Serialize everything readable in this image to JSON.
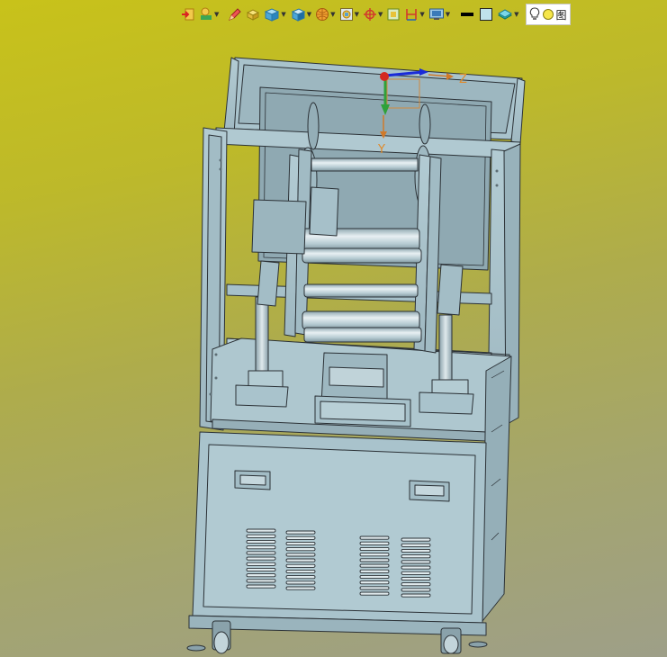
{
  "viewport": {
    "background_top": "#c8c21a",
    "background_bottom": "#9e9f88",
    "model_color": "#a9c3cc",
    "edge_color": "#2b3136"
  },
  "toolbar": {
    "buttons": [
      {
        "name": "exit-sketch-icon",
        "dropdown": false
      },
      {
        "name": "sketch-tools-icon",
        "dropdown": true
      },
      {
        "name": "edit-pencil-icon",
        "dropdown": false
      },
      {
        "name": "extrude-block-icon",
        "dropdown": false
      },
      {
        "name": "solid-cube-icon",
        "dropdown": true
      },
      {
        "name": "view-orientation-icon",
        "dropdown": true
      },
      {
        "name": "render-sphere-icon",
        "dropdown": true
      },
      {
        "name": "display-style-icon",
        "dropdown": true
      },
      {
        "name": "snap-target-icon",
        "dropdown": true
      },
      {
        "name": "section-view-icon",
        "dropdown": false
      },
      {
        "name": "dimension-icon",
        "dropdown": true
      },
      {
        "name": "screen-capture-icon",
        "dropdown": true
      },
      {
        "name": "line-color-icon",
        "dropdown": false
      },
      {
        "name": "fill-color-icon",
        "dropdown": false
      },
      {
        "name": "layer-icon",
        "dropdown": true
      }
    ],
    "view_label": "图"
  },
  "triad": {
    "z_label": "Z",
    "y_label": "Y"
  }
}
